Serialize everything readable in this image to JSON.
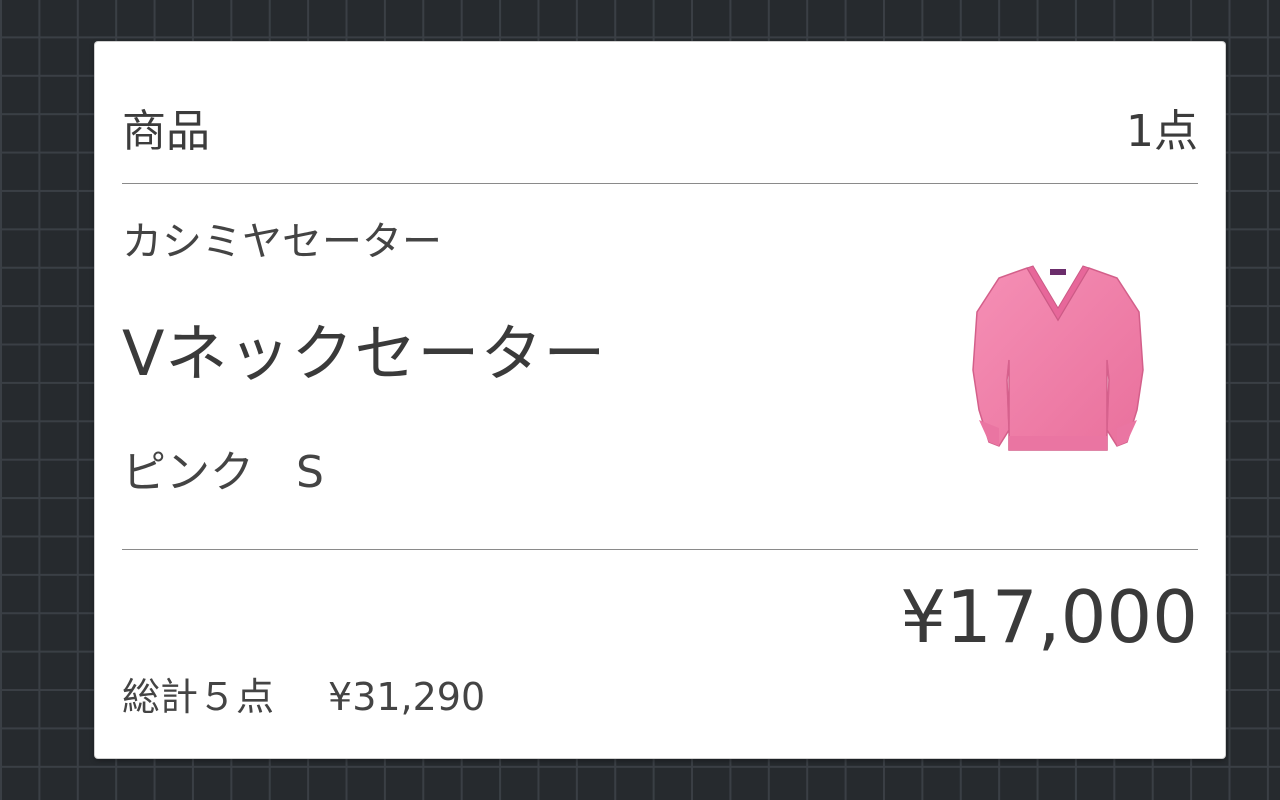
{
  "cart": {
    "header_label": "商品",
    "item_count": "1点"
  },
  "item": {
    "brand": "カシミヤセーター",
    "name": "Vネックセーター",
    "color": "ピンク",
    "size": "S",
    "price": "¥17,000",
    "image_icon": "pink-vneck-sweater-image",
    "color_hex": "#f07ca4"
  },
  "summary": {
    "total_items": "総計５点",
    "total_price": "¥31,290"
  }
}
